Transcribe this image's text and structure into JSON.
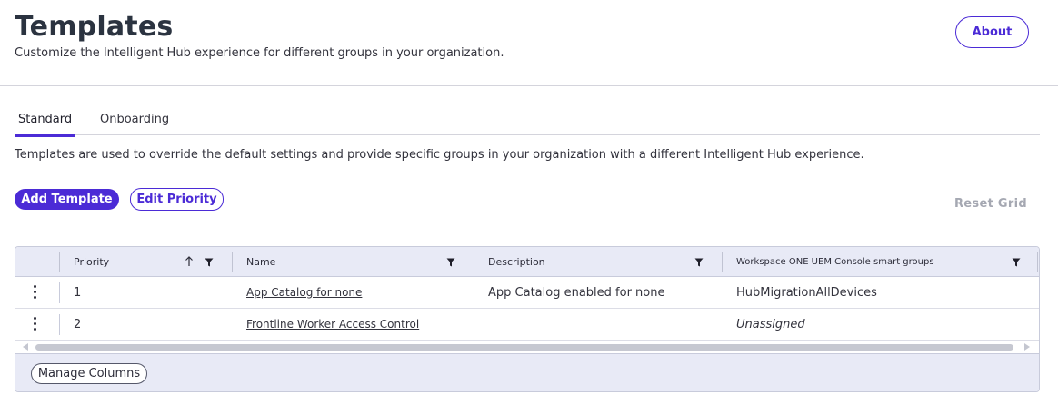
{
  "header": {
    "title": "Templates",
    "subtitle": "Customize the Intelligent Hub experience for different groups in your organization.",
    "about_label": "About"
  },
  "tabs": [
    {
      "label": "Standard",
      "selected": true
    },
    {
      "label": "Onboarding",
      "selected": false
    }
  ],
  "description": "Templates are used to override the default settings and provide specific groups in your organization with a different Intelligent Hub experience.",
  "toolbar": {
    "add_template_label": "Add Template",
    "edit_priority_label": "Edit Priority",
    "reset_grid_label": "Reset Grid"
  },
  "grid": {
    "columns": [
      {
        "label": "Priority",
        "sort": "ascending",
        "filter": true
      },
      {
        "label": "Name",
        "filter": true
      },
      {
        "label": "Description",
        "filter": true
      },
      {
        "label": "Workspace ONE UEM Console smart groups",
        "filter": true
      }
    ],
    "rows": [
      {
        "priority": "1",
        "name": "App Catalog for none",
        "description": "App Catalog enabled for none",
        "smart_groups": "HubMigrationAllDevices"
      },
      {
        "priority": "2",
        "name": "Frontline Worker Access Control",
        "description": "",
        "smart_groups": "Unassigned"
      }
    ],
    "manage_columns_label": "Manage Columns"
  },
  "icons": {
    "filter": "filter-funnel-icon",
    "sort": "sort-ascending-arrow-icon",
    "row_menu": "kebab-menu-icon"
  },
  "colors": {
    "accent": "#4b2bd6",
    "header_bg": "#e8eaf6",
    "muted": "#a5a8b2"
  }
}
